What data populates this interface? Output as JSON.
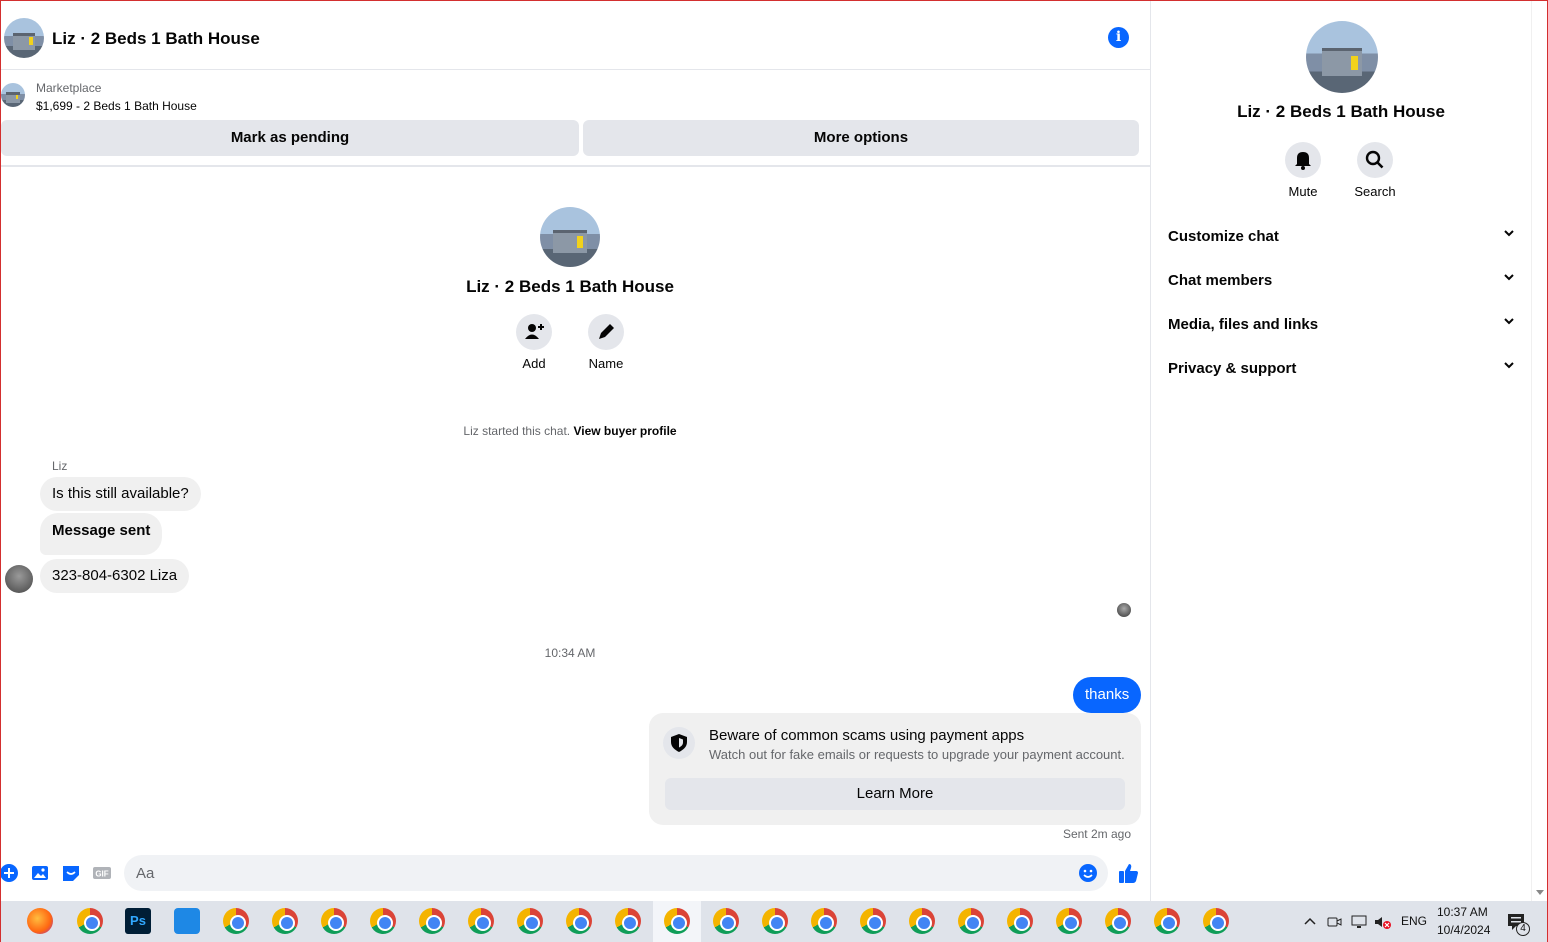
{
  "header": {
    "title": "Liz · 2 Beds 1 Bath House",
    "info_icon": "info-icon"
  },
  "marketplace": {
    "label": "Marketplace",
    "listing": "$1,699 - 2 Beds 1 Bath House",
    "mark_pending": "Mark as pending",
    "more_options": "More options"
  },
  "profile": {
    "name": "Liz · 2 Beds 1 Bath House",
    "add_label": "Add",
    "name_label": "Name"
  },
  "thread": {
    "started_text": "Liz started this chat.",
    "view_buyer": "View buyer profile",
    "sender": "Liz",
    "messages": [
      {
        "text": "Is this still available?"
      },
      {
        "text": "Message sent"
      },
      {
        "text": "323-804-6302 Liza"
      }
    ],
    "timestamp": "10:34 AM",
    "my_message": "thanks",
    "scam_title": "Beware of common scams using payment apps",
    "scam_sub": "Watch out for fake emails or requests to upgrade your payment account.",
    "learn_more": "Learn More",
    "sent_ago": "Sent 2m ago"
  },
  "composer": {
    "placeholder": "Aa"
  },
  "panel": {
    "name": "Liz · 2 Beds 1 Bath House",
    "mute": "Mute",
    "search": "Search",
    "sections": [
      {
        "label": "Customize chat"
      },
      {
        "label": "Chat members"
      },
      {
        "label": "Media, files and links"
      },
      {
        "label": "Privacy & support"
      }
    ]
  },
  "taskbar": {
    "lang": "ENG",
    "time": "10:37 AM",
    "date": "10/4/2024",
    "notif_count": "4"
  },
  "colors": {
    "accent": "#0866ff",
    "bubble_gray": "#f0f0f0",
    "button_gray": "#e4e6eb"
  }
}
